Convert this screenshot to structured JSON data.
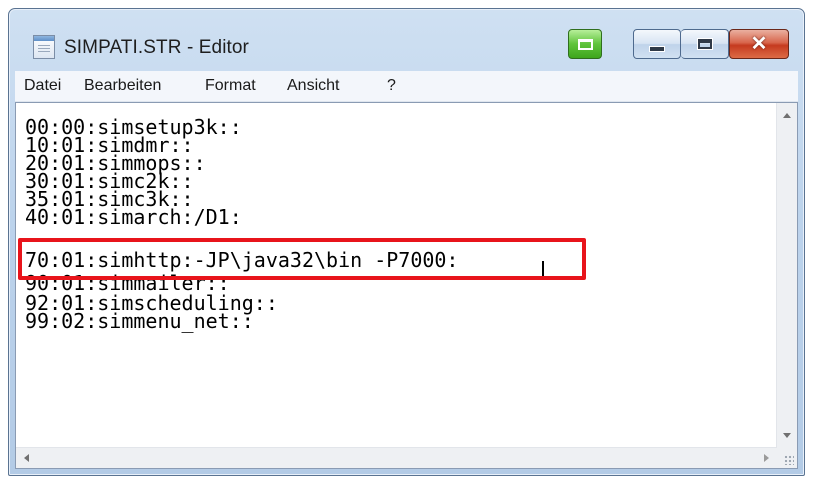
{
  "window": {
    "title": "SIMPATI.STR - Editor",
    "close_glyph": "✕"
  },
  "menu": [
    "Datei",
    "Bearbeiten",
    "Format",
    "Ansicht",
    "?"
  ],
  "editor": {
    "lines": [
      "00:00:simsetup3k::",
      "10:01:simdmr::",
      "20:01:simmops::",
      "30:01:simc2k::",
      "35:01:simc3k::",
      "40:01:simarch:/D1:",
      "70:01:simhttp:-JP\\java32\\bin -P7000:",
      "90:01:simmailer::",
      "92:01:simscheduling::",
      "99:02:simmenu_net::"
    ],
    "highlighted_line_index": 6
  },
  "colors": {
    "highlight": "#e8141b",
    "title_bar": "#bcd3ec"
  },
  "icons": {
    "app": "notepad-document-icon",
    "extra": "green-edit-icon",
    "minimize": "minimize-icon",
    "maximize": "maximize-icon",
    "close": "close-icon"
  }
}
